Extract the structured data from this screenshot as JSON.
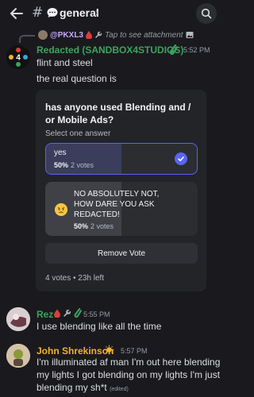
{
  "header": {
    "channel_name": "general",
    "chevron": "›"
  },
  "reply": {
    "username": "@PKXL3",
    "preview": "Tap to see attachment"
  },
  "messages": [
    {
      "author": "Redacted (SANDBOX4STUDIOS)",
      "author_color": "#3ba55c",
      "time": "5:52 PM",
      "lines": [
        "flint and steel",
        "the real question is"
      ]
    },
    {
      "author": "Rez",
      "author_color": "#3ba55c",
      "time": "5:55 PM",
      "text": "I use blending like all the time"
    },
    {
      "author": "John Shrekinson",
      "author_color": "#f0b132",
      "time": "5:57 PM",
      "text_lines": [
        "I'm illuminated af man I'm out here blending",
        "my lights I got blending on my lights I'm just",
        "blending my sh*t"
      ],
      "edited": "(edited)"
    }
  ],
  "poll": {
    "question": "has anyone used Blending and / or Mobile Ads?",
    "instruction": "Select one answer",
    "options": [
      {
        "label": "yes",
        "percent": "50%",
        "votes": "2 votes",
        "fraction": 0.5,
        "selected": true
      },
      {
        "label_lines": [
          "NO ABSOLUTELY NOT,",
          "HOW DARE YOU ASK",
          "REDACTED!"
        ],
        "percent": "50%",
        "votes": "2 votes",
        "fraction": 0.5,
        "selected": false
      }
    ],
    "remove_vote_label": "Remove Vote",
    "footer": "4 votes • 23h left"
  },
  "colors": {
    "accent": "#5865f2",
    "background": "#1a1a1e",
    "poll_bg": "#232428"
  },
  "icons": [
    "back-arrow-icon",
    "speech-bubble-icon",
    "search-icon",
    "checkmark-icon",
    "wrench-icon",
    "blood-drop-icon",
    "image-icon",
    "test-tube-icon",
    "sun-badge-icon",
    "angry-face-icon"
  ]
}
